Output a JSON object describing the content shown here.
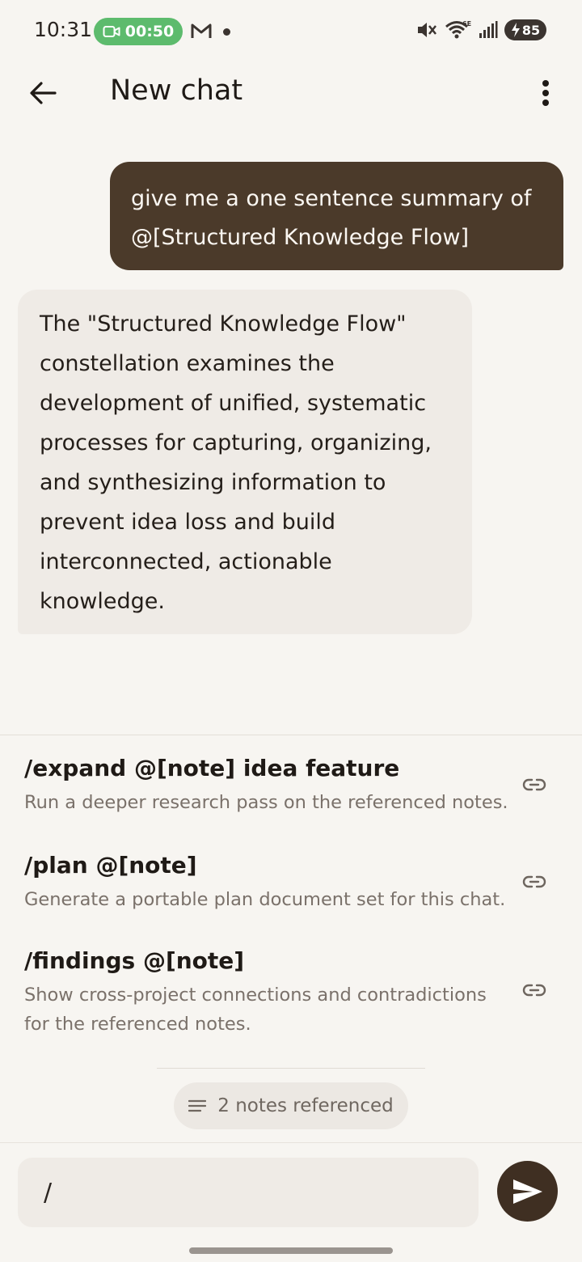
{
  "status_bar": {
    "time": "10:31",
    "recording_time": "00:50",
    "battery": "85",
    "network": "6E"
  },
  "header": {
    "title": "New chat"
  },
  "messages": [
    {
      "role": "user",
      "text": "give me a one sentence summary of @[Structured Knowledge Flow]"
    },
    {
      "role": "assistant",
      "text": "The \"Structured Knowledge Flow\" constellation examines the development of unified, systematic processes for capturing, organizing, and synthesizing information to prevent idea loss and build interconnected, actionable knowledge."
    }
  ],
  "commands": [
    {
      "title": "/expand @[note] idea feature",
      "description": "Run a deeper research pass on the referenced notes."
    },
    {
      "title": "/plan @[note]",
      "description": "Generate a portable plan document set for this chat."
    },
    {
      "title": "/findings @[note]",
      "description": "Show cross-project connections and contradictions for the referenced notes."
    }
  ],
  "notes_chip": {
    "label": "2 notes referenced"
  },
  "composer": {
    "value": "/"
  },
  "colors": {
    "background": "#f7f5f1",
    "user_bubble": "#4b3a2a",
    "assistant_bubble": "#efebe6",
    "recording": "#5dbb6d",
    "send_button": "#3f2f22"
  }
}
